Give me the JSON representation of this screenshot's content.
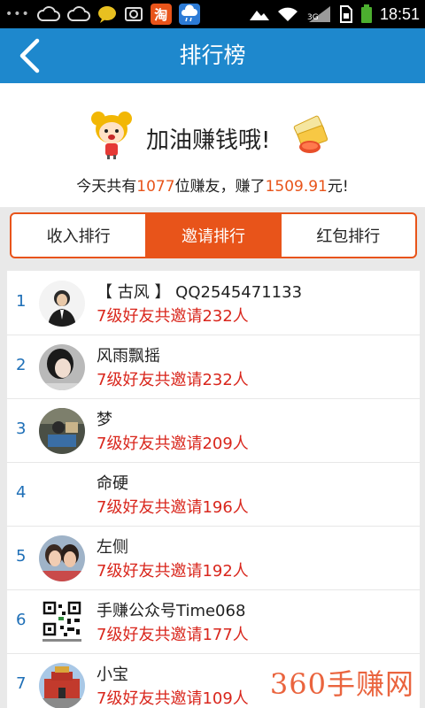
{
  "status_bar": {
    "time": "18:51",
    "app_taobao_label": "淘",
    "signal_label": "3G",
    "icons": [
      "more-dots-icon",
      "cloud-icon",
      "cloud-icon",
      "chat-icon",
      "screenshot-icon",
      "taobao-app-icon",
      "weather-app-icon",
      "mountain-icon",
      "wifi-icon",
      "signal-icon",
      "sim-icon",
      "battery-icon"
    ]
  },
  "header": {
    "title": "排行榜"
  },
  "banner": {
    "slogan": "加油赚钱哦!",
    "summary_prefix": "今天共有",
    "friends_count": "1077",
    "summary_middle": "位赚友，赚了",
    "amount": "1509.91",
    "summary_suffix": "元!"
  },
  "tabs": [
    {
      "label": "收入排行",
      "active": false
    },
    {
      "label": "邀请排行",
      "active": true
    },
    {
      "label": "红包排行",
      "active": false
    }
  ],
  "ranking": [
    {
      "rank": "1",
      "name": "【 古风 】 QQ2545471133",
      "invite": "7级好友共邀请232人"
    },
    {
      "rank": "2",
      "name": "风雨飘摇",
      "invite": "7级好友共邀请232人"
    },
    {
      "rank": "3",
      "name": "梦",
      "invite": "7级好友共邀请209人"
    },
    {
      "rank": "4",
      "name": "命硬",
      "invite": "7级好友共邀请196人"
    },
    {
      "rank": "5",
      "name": "左侧",
      "invite": "7级好友共邀请192人"
    },
    {
      "rank": "6",
      "name": "手赚公众号Time068",
      "invite": "7级好友共邀请177人"
    },
    {
      "rank": "7",
      "name": "小宝",
      "invite": "7级好友共邀请109人"
    }
  ],
  "watermark": "360手赚网",
  "colors": {
    "accent": "#e8541a",
    "titlebar": "#1e88cd",
    "invite": "#d9261c",
    "rank": "#1e6fb7"
  }
}
